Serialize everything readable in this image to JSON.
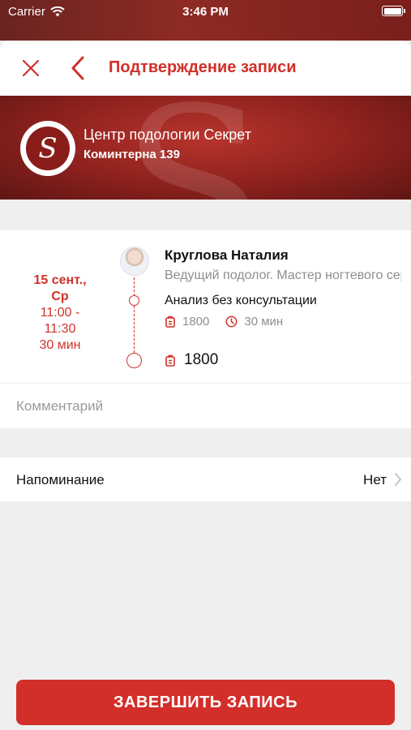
{
  "status_bar": {
    "carrier": "Carrier",
    "time": "3:46 PM"
  },
  "nav": {
    "title": "Подтверждение записи"
  },
  "organization": {
    "name": "Центр подологии Секрет",
    "address": "Коминтерна 139",
    "logo_letter": "S"
  },
  "booking": {
    "date_line1": "15 сент.,",
    "date_line2": "Ср",
    "time_line1": "11:00 -",
    "time_line2": "11:30",
    "duration": "30 мин",
    "master_name": "Круглова Наталия",
    "master_role": "Ведущий подолог. Мастер ногтевого сервиса",
    "service_name": "Анализ без консультации",
    "service_price": "1800",
    "service_duration": "30 мин",
    "total": "1800"
  },
  "comment": {
    "placeholder": "Комментарий",
    "value": ""
  },
  "reminder": {
    "label": "Напоминание",
    "value": "Нет"
  },
  "finish_button": {
    "label": "ЗАВЕРШИТЬ ЗАПИСЬ"
  },
  "colors": {
    "accent": "#d0302a",
    "button": "#d32f2a",
    "banner": "#8d211d"
  }
}
